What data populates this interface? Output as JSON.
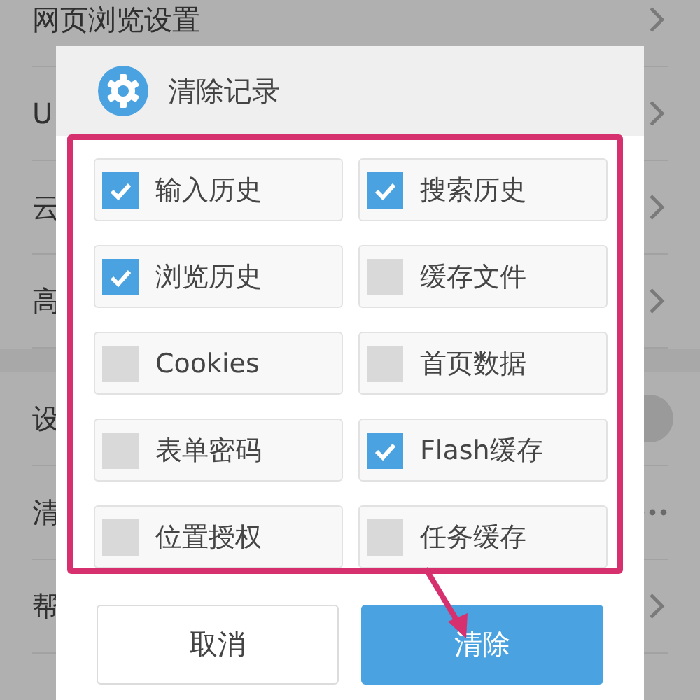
{
  "settings_sections": [
    [
      {
        "label": "网页浏览设置",
        "kind": "chevron"
      },
      {
        "label": "U",
        "kind": "chevron"
      },
      {
        "label": "云",
        "kind": "chevron"
      },
      {
        "label": "高",
        "kind": "chevron"
      }
    ],
    [
      {
        "label": "设",
        "kind": "toggle"
      },
      {
        "label": "清",
        "kind": "more"
      },
      {
        "label": "帮",
        "kind": "chevron"
      }
    ]
  ],
  "dialog": {
    "title": "清除记录",
    "options": [
      {
        "label": "输入历史",
        "checked": true
      },
      {
        "label": "搜索历史",
        "checked": true
      },
      {
        "label": "浏览历史",
        "checked": true
      },
      {
        "label": "缓存文件",
        "checked": false
      },
      {
        "label": "Cookies",
        "checked": false
      },
      {
        "label": "首页数据",
        "checked": false
      },
      {
        "label": "表单密码",
        "checked": false
      },
      {
        "label": "Flash缓存",
        "checked": true
      },
      {
        "label": "位置授权",
        "checked": false
      },
      {
        "label": "任务缓存",
        "checked": false
      }
    ],
    "buttons": [
      {
        "label": "取消",
        "kind": "secondary"
      },
      {
        "label": "清除",
        "kind": "primary"
      }
    ]
  },
  "annotation": {
    "highlight_frame": true,
    "pointer_arrow": true
  }
}
